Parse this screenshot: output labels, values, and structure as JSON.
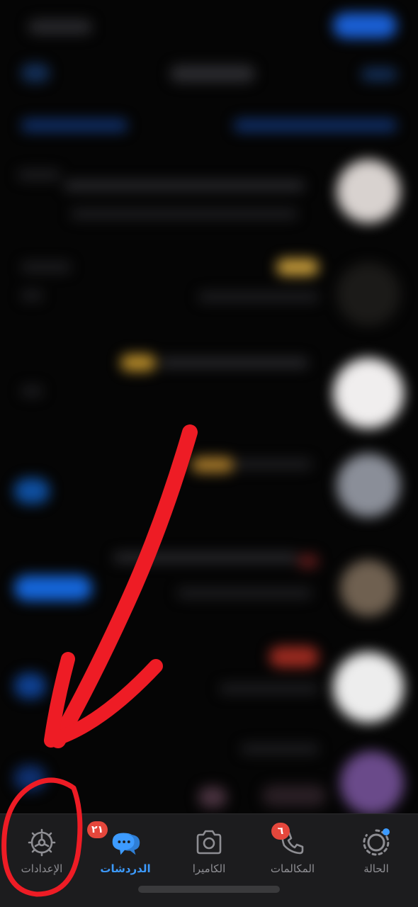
{
  "tabs": [
    {
      "id": "status",
      "label": "الحالة",
      "icon": "status-icon",
      "has_dot": true
    },
    {
      "id": "calls",
      "label": "المكالمات",
      "icon": "phone-icon",
      "badge": "٦"
    },
    {
      "id": "camera",
      "label": "الكاميرا",
      "icon": "camera-icon"
    },
    {
      "id": "chats",
      "label": "الدردشات",
      "icon": "chats-icon",
      "badge": "٢١",
      "active": true
    },
    {
      "id": "settings",
      "label": "الإعدادات",
      "icon": "gear-icon"
    }
  ],
  "colors": {
    "accent": "#3d9bff",
    "badge": "#e5473c",
    "annotation": "#ee1c25",
    "tabbar_bg": "#1c1c1e"
  },
  "annotation": {
    "type": "hand-drawn arrow and circle",
    "target": "settings tab"
  }
}
